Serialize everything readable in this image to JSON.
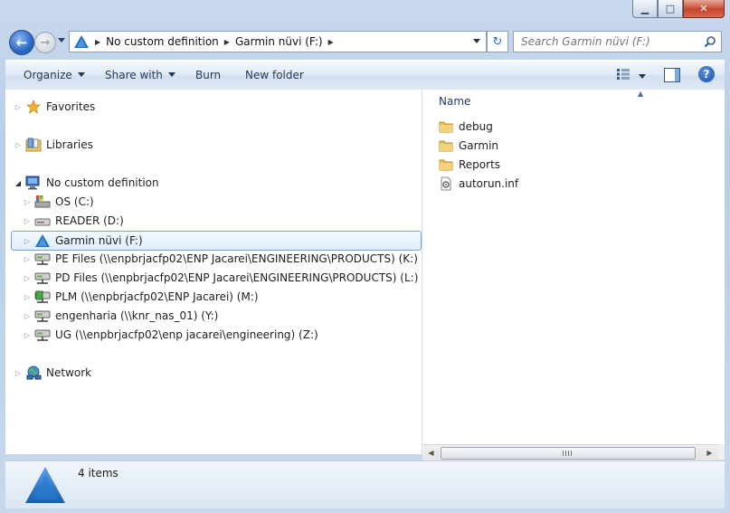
{
  "window": {
    "caption_buttons": {
      "minimize": "▁",
      "maximize": "□",
      "close": "✕"
    }
  },
  "address": {
    "crumbs": [
      "No custom definition",
      "Garmin nüvi (F:)"
    ],
    "refresh_glyph": "↻"
  },
  "search": {
    "placeholder": "Search Garmin nüvi (F:)"
  },
  "toolbar": {
    "organize": "Organize",
    "share_with": "Share with",
    "burn": "Burn",
    "new_folder": "New folder",
    "help": "?"
  },
  "nav_tree": {
    "favorites": "Favorites",
    "libraries": "Libraries",
    "computer": "No custom definition",
    "drives": [
      {
        "label": "OS (C:)",
        "icon": "os-drive-icon"
      },
      {
        "label": "READER (D:)",
        "icon": "removable-drive-icon"
      },
      {
        "label": "Garmin nüvi (F:)",
        "icon": "garmin-drive-icon",
        "selected": true
      },
      {
        "label": "PE Files (\\\\enpbrjacfp02\\ENP Jacarei\\ENGINEERING\\PRODUCTS) (K:)",
        "icon": "network-drive-icon"
      },
      {
        "label": "PD Files (\\\\enpbrjacfp02\\ENP Jacarei\\ENGINEERING\\PRODUCTS) (L:)",
        "icon": "network-drive-icon"
      },
      {
        "label": "PLM (\\\\enpbrjacfp02\\ENP Jacarei) (M:)",
        "icon": "network-drive-icon"
      },
      {
        "label": "engenharia (\\\\knr_nas_01) (Y:)",
        "icon": "network-drive-icon"
      },
      {
        "label": "UG (\\\\enpbrjacfp02\\enp jacarei\\engineering) (Z:)",
        "icon": "network-drive-icon"
      }
    ],
    "network": "Network"
  },
  "file_list": {
    "column_name": "Name",
    "items": [
      {
        "name": "debug",
        "icon": "folder-icon"
      },
      {
        "name": "Garmin",
        "icon": "folder-icon"
      },
      {
        "name": "Reports",
        "icon": "folder-icon"
      },
      {
        "name": "autorun.inf",
        "icon": "settings-file-icon"
      }
    ]
  },
  "status": {
    "items_count": "4 items"
  },
  "colors": {
    "accent": "#1b4f9a",
    "selection_border": "#7da2ce",
    "garmin_blue": "#1f6fc2"
  }
}
